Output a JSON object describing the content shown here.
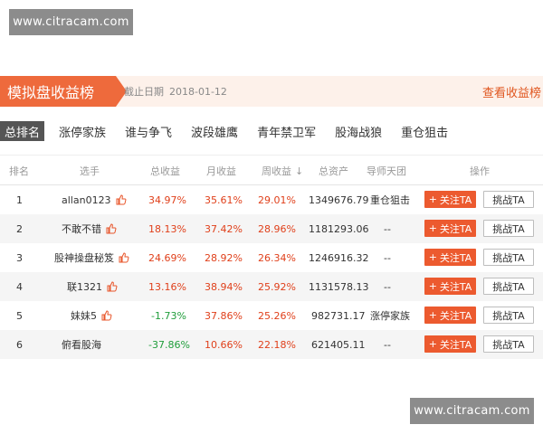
{
  "watermark": "www.citracam.com",
  "banner": {
    "title": "模拟盘收益榜",
    "date_label": "截止日期",
    "date": "2018-01-12",
    "link": "查看收益榜"
  },
  "tabs": [
    "总排名",
    "涨停家族",
    "谁与争飞",
    "波段雄鹰",
    "青年禁卫军",
    "股海战狼",
    "重仓狙击"
  ],
  "columns": {
    "rank": "排名",
    "player": "选手",
    "total": "总收益",
    "month": "月收益",
    "week": "周收益",
    "week_sort": "↓",
    "assets": "总资产",
    "team": "导师天团",
    "action": "操作"
  },
  "rows": [
    {
      "rank": "1",
      "name": "allan0123",
      "total": "34.97%",
      "month": "35.61%",
      "week": "29.01%",
      "assets": "1349676.79",
      "team": "重仓狙击",
      "follow": "关注TA",
      "challenge": "挑战TA"
    },
    {
      "rank": "2",
      "name": "不敢不错",
      "total": "18.13%",
      "month": "37.42%",
      "week": "28.96%",
      "assets": "1181293.06",
      "team": "--",
      "follow": "关注TA",
      "challenge": "挑战TA"
    },
    {
      "rank": "3",
      "name": "股神操盘秘笈",
      "total": "24.69%",
      "month": "28.92%",
      "week": "26.34%",
      "assets": "1246916.32",
      "team": "--",
      "follow": "关注TA",
      "challenge": "挑战TA"
    },
    {
      "rank": "4",
      "name": "联1321",
      "total": "13.16%",
      "month": "38.94%",
      "week": "25.92%",
      "assets": "1131578.13",
      "team": "--",
      "follow": "关注TA",
      "challenge": "挑战TA"
    },
    {
      "rank": "5",
      "name": "妹妹5",
      "total": "-1.73%",
      "month": "37.86%",
      "week": "25.26%",
      "assets": "982731.17",
      "team": "涨停家族",
      "follow": "关注TA",
      "challenge": "挑战TA"
    },
    {
      "rank": "6",
      "name": "俯看股海",
      "total": "-37.86%",
      "month": "10.66%",
      "week": "22.18%",
      "assets": "621405.11",
      "team": "--",
      "follow": "关注TA",
      "challenge": "挑战TA"
    }
  ]
}
